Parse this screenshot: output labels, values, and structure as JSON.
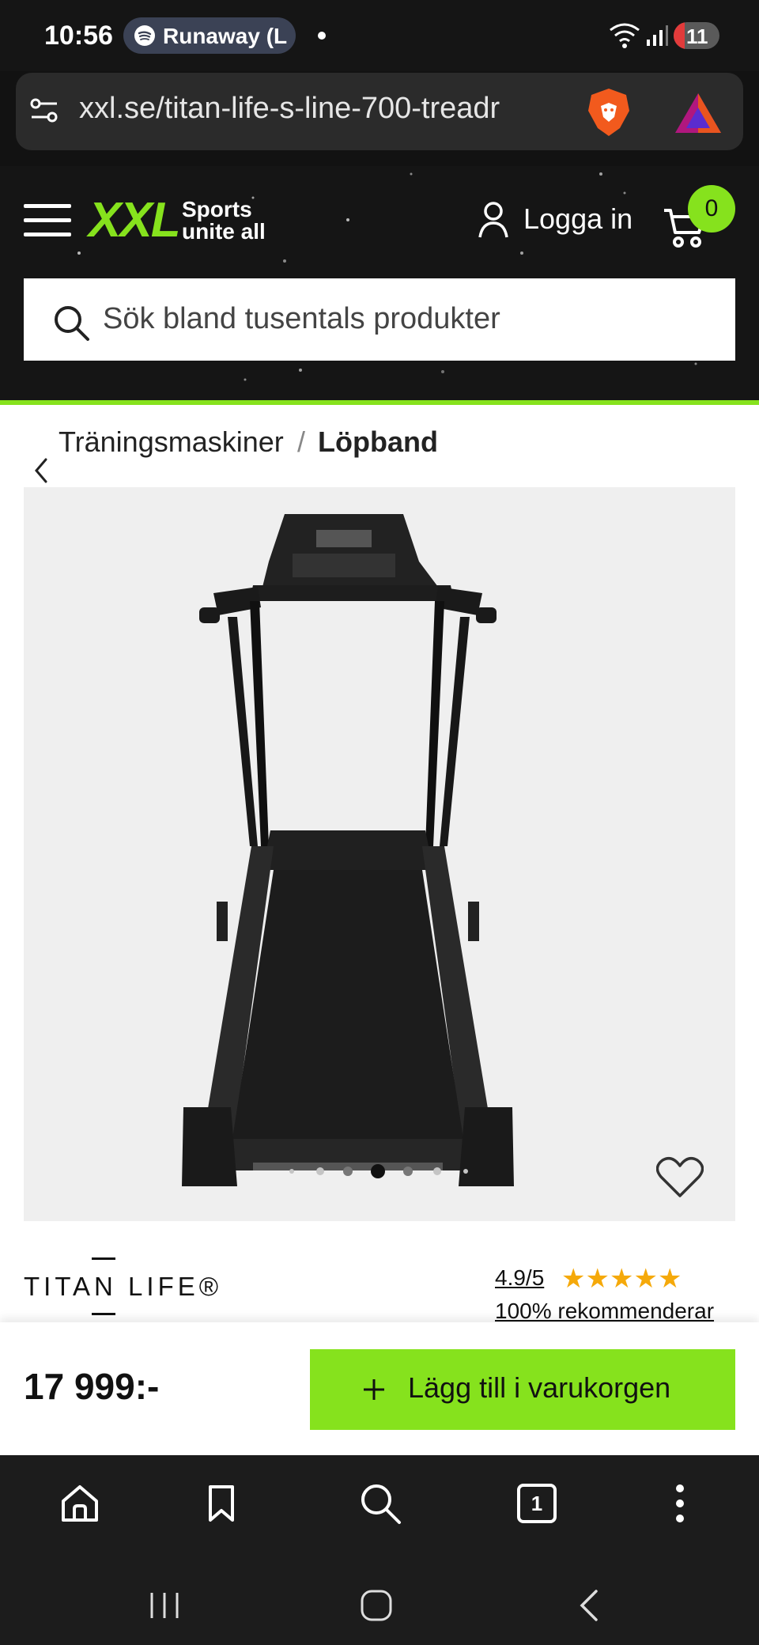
{
  "status": {
    "time": "10:56",
    "media_pill": "Runaway (L",
    "battery": "11"
  },
  "browser": {
    "url": "xxl.se/titan-life-s-line-700-treadr"
  },
  "site": {
    "logo_text": "XXL",
    "tagline_1": "Sports",
    "tagline_2": "unite all",
    "login_label": "Logga in",
    "cart_count": "0",
    "search_placeholder": "Sök bland tusentals produkter",
    "brand_green": "#86e21d"
  },
  "breadcrumb": {
    "parent": "Träningsmaskiner",
    "separator": "/",
    "current": "Löpband"
  },
  "product": {
    "brand_logo": "TITAN LIFE®",
    "rating": "4.9/5",
    "recommend": "100% rekommenderar",
    "stars": 5,
    "gallery_total": 7,
    "gallery_active": 4,
    "price": "17 999:-",
    "add_to_cart_label": "Lägg till i varukorgen"
  },
  "nav": {
    "tabs_count": "1"
  }
}
